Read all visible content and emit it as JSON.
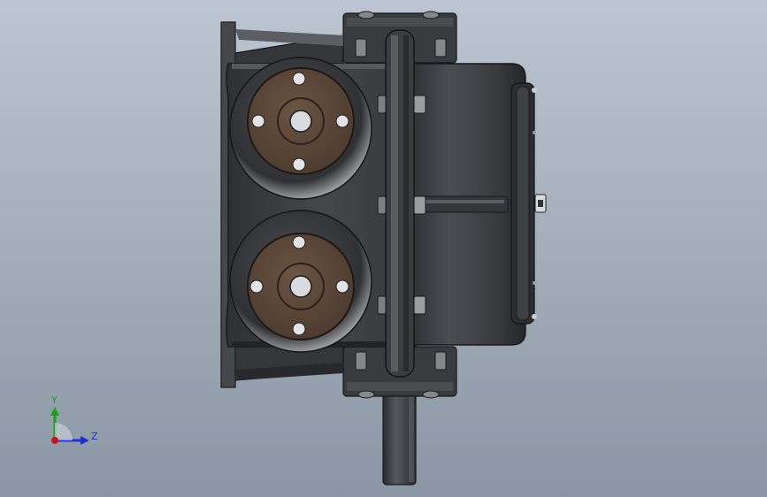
{
  "viewport": {
    "background_top": "#b9c3cf",
    "background_bottom": "#8d99a6"
  },
  "model": {
    "body_color": "#3b3c40",
    "body_highlight": "#5c5e63",
    "flange_color": "#5a4536",
    "flange_rim": "#2c221b",
    "bolt_color": "#c9cbcf",
    "hole_color": "#dfe1e4"
  },
  "triad": {
    "y_label": "Y",
    "z_label": "Z",
    "y_color": "#1aa31a",
    "z_color": "#1f2fd6",
    "x_color": "#d01010"
  }
}
